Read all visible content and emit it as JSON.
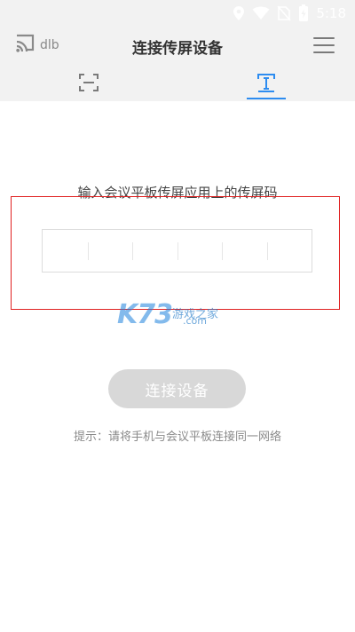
{
  "status_bar": {
    "time": "5:18",
    "icons": [
      "location-icon",
      "wifi-icon",
      "no-sim-icon",
      "battery-icon"
    ]
  },
  "header": {
    "device_name": "dlb",
    "title": "连接传屏设备",
    "tabs": [
      {
        "name": "scan",
        "icon": "scan-icon",
        "active": false
      },
      {
        "name": "code",
        "icon": "code-input-icon",
        "active": true
      }
    ]
  },
  "main": {
    "instruction": "输入会议平板传屏应用上的传屏码",
    "code_digits": [
      "",
      "",
      "",
      "",
      "",
      ""
    ],
    "connect_label": "连接设备",
    "hint": "提示：请将手机与会议平板连接同一网络"
  },
  "watermark": {
    "logo": "K73",
    "title": "游戏之家",
    "domain": ".com"
  },
  "colors": {
    "accent": "#2d8cf0",
    "header_bg": "#f2f2f2",
    "button_disabled": "#d8d8d8",
    "highlight_box": "#e02020"
  }
}
